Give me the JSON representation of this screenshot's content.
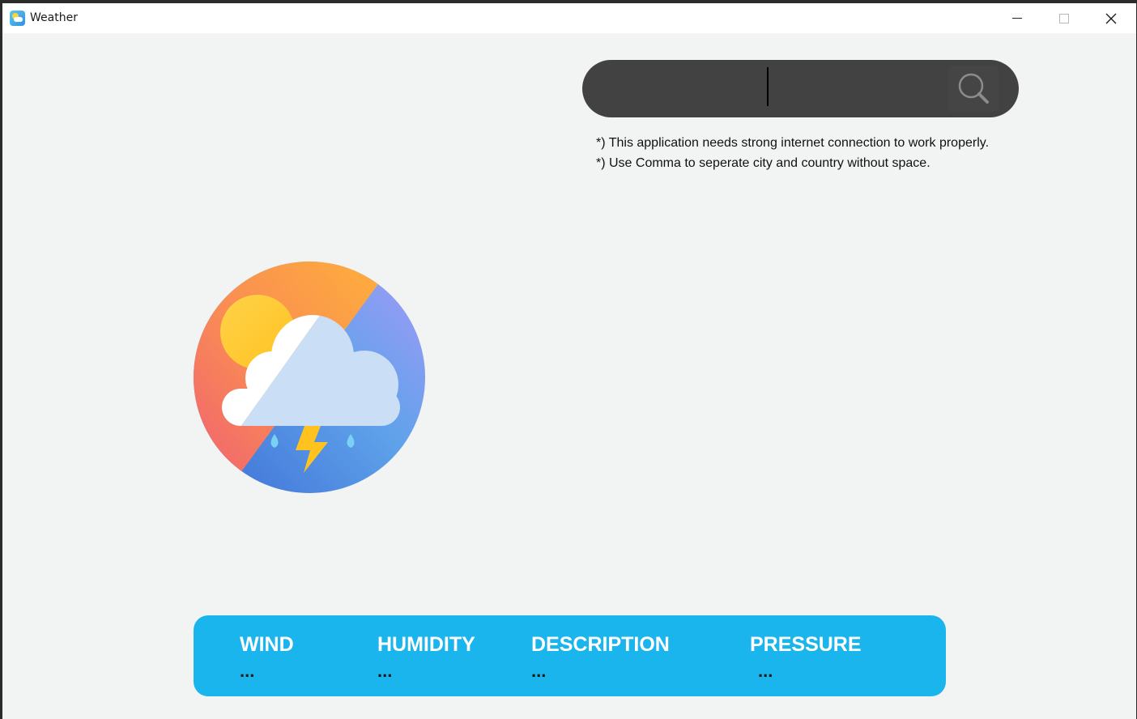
{
  "window": {
    "title": "Weather"
  },
  "search": {
    "value": "",
    "icon": "search-icon"
  },
  "notes": [
    "*) This application needs strong internet connection to work properly.",
    "*) Use Comma to seperate city and country without space."
  ],
  "logo": {
    "icon": "weather-logo-icon"
  },
  "info": {
    "wind": {
      "label": "WIND",
      "value": "..."
    },
    "humidity": {
      "label": "HUMIDITY",
      "value": "..."
    },
    "description": {
      "label": "DESCRIPTION",
      "value": "..."
    },
    "pressure": {
      "label": "PRESSURE",
      "value": "..."
    }
  },
  "colors": {
    "background": "#f2f4f4",
    "search_bar": "#424242",
    "panel": "#1bb5ee",
    "panel_label": "#ffffff",
    "panel_value": "#1b1b1b"
  }
}
